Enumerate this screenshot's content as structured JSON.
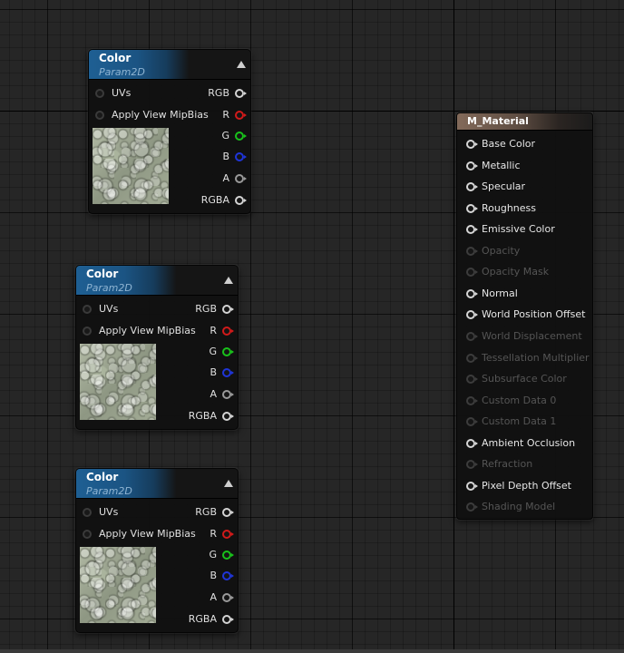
{
  "texture_nodes": [
    {
      "title": "Color",
      "subtitle": "Param2D",
      "inputs": [
        "UVs",
        "Apply View MipBias"
      ],
      "outputs": [
        {
          "label": "RGB",
          "pin": "white"
        },
        {
          "label": "R",
          "pin": "red"
        },
        {
          "label": "G",
          "pin": "green"
        },
        {
          "label": "B",
          "pin": "blue"
        },
        {
          "label": "A",
          "pin": "grey"
        },
        {
          "label": "RGBA",
          "pin": "white"
        }
      ]
    },
    {
      "title": "Color",
      "subtitle": "Param2D",
      "inputs": [
        "UVs",
        "Apply View MipBias"
      ],
      "outputs": [
        {
          "label": "RGB",
          "pin": "white"
        },
        {
          "label": "R",
          "pin": "red"
        },
        {
          "label": "G",
          "pin": "green"
        },
        {
          "label": "B",
          "pin": "blue"
        },
        {
          "label": "A",
          "pin": "grey"
        },
        {
          "label": "RGBA",
          "pin": "white"
        }
      ]
    },
    {
      "title": "Color",
      "subtitle": "Param2D",
      "inputs": [
        "UVs",
        "Apply View MipBias"
      ],
      "outputs": [
        {
          "label": "RGB",
          "pin": "white"
        },
        {
          "label": "R",
          "pin": "red"
        },
        {
          "label": "G",
          "pin": "green"
        },
        {
          "label": "B",
          "pin": "blue"
        },
        {
          "label": "A",
          "pin": "grey"
        },
        {
          "label": "RGBA",
          "pin": "white"
        }
      ]
    }
  ],
  "material_node": {
    "title": "M_Material",
    "inputs": [
      {
        "label": "Base Color",
        "enabled": true
      },
      {
        "label": "Metallic",
        "enabled": true
      },
      {
        "label": "Specular",
        "enabled": true
      },
      {
        "label": "Roughness",
        "enabled": true
      },
      {
        "label": "Emissive Color",
        "enabled": true
      },
      {
        "label": "Opacity",
        "enabled": false
      },
      {
        "label": "Opacity Mask",
        "enabled": false
      },
      {
        "label": "Normal",
        "enabled": true
      },
      {
        "label": "World Position Offset",
        "enabled": true
      },
      {
        "label": "World Displacement",
        "enabled": false
      },
      {
        "label": "Tessellation Multiplier",
        "enabled": false
      },
      {
        "label": "Subsurface Color",
        "enabled": false
      },
      {
        "label": "Custom Data 0",
        "enabled": false
      },
      {
        "label": "Custom Data 1",
        "enabled": false
      },
      {
        "label": "Ambient Occlusion",
        "enabled": true
      },
      {
        "label": "Refraction",
        "enabled": false
      },
      {
        "label": "Pixel Depth Offset",
        "enabled": true
      },
      {
        "label": "Shading Model",
        "enabled": false
      }
    ]
  },
  "colors": {
    "graph_background": "#262626",
    "texture_header": "#1e5f93",
    "material_header": "#836a5a",
    "pin_red": "#d11a1a",
    "pin_green": "#19c21b",
    "pin_blue": "#1f35d8"
  },
  "icons": {
    "collapse": "collapse-arrow-icon",
    "input_pin": "input-pin-icon",
    "output_pin": "output-pin-icon",
    "texture_preview": "texture-preview-image"
  }
}
